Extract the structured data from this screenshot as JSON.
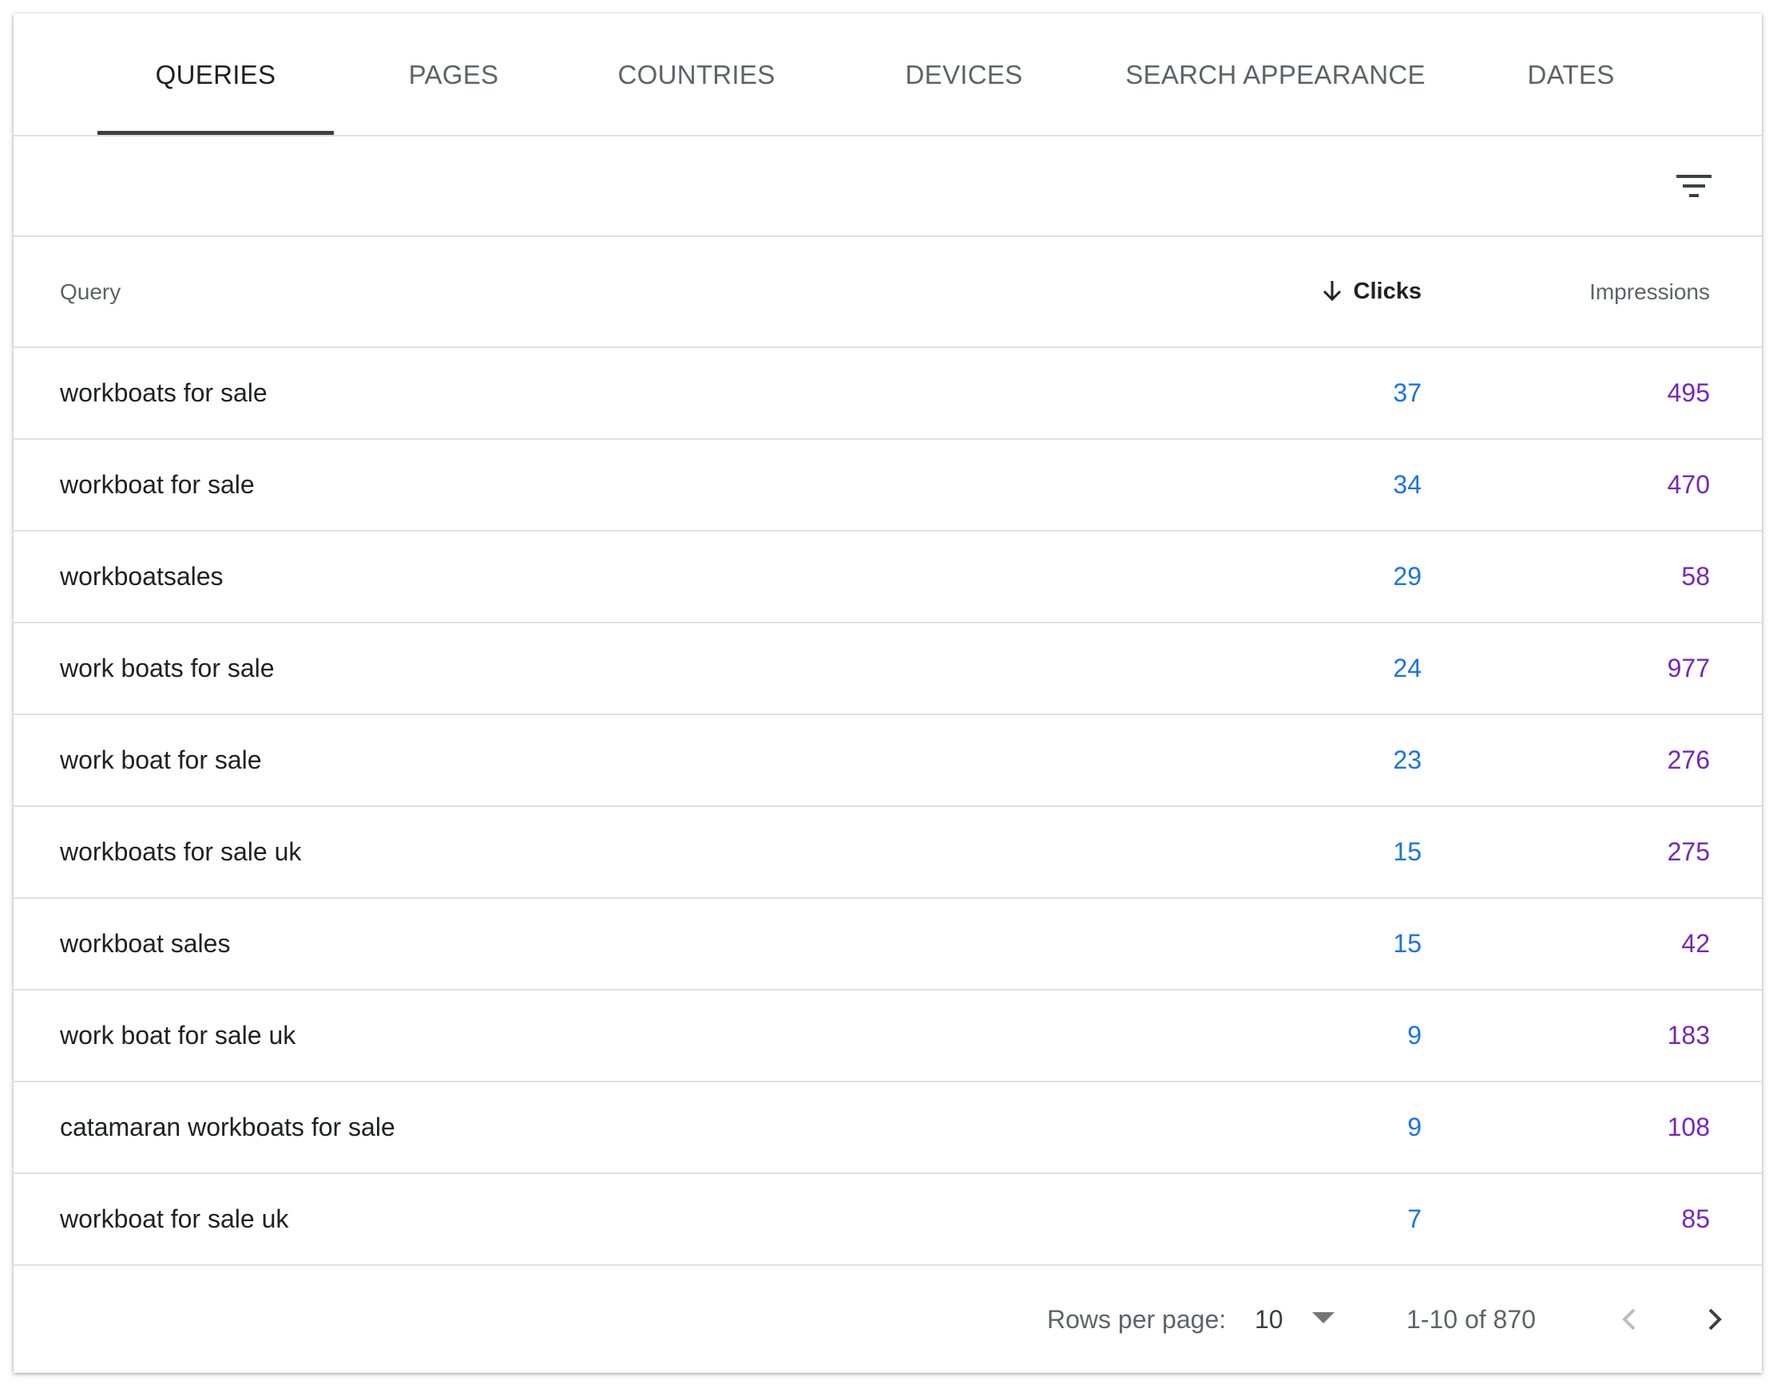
{
  "tabs": [
    {
      "label": "QUERIES",
      "active": true
    },
    {
      "label": "PAGES",
      "active": false
    },
    {
      "label": "COUNTRIES",
      "active": false
    },
    {
      "label": "DEVICES",
      "active": false
    },
    {
      "label": "SEARCH APPEARANCE",
      "active": false
    },
    {
      "label": "DATES",
      "active": false
    }
  ],
  "toolbar": {
    "filter_icon": "filter-list-icon"
  },
  "table": {
    "headers": {
      "query": "Query",
      "clicks": "Clicks",
      "impressions": "Impressions"
    },
    "sort": {
      "column": "clicks",
      "direction": "descending",
      "icon": "arrow-down-icon"
    },
    "rows": [
      {
        "query": "workboats for sale",
        "clicks": "37",
        "impressions": "495"
      },
      {
        "query": "workboat for sale",
        "clicks": "34",
        "impressions": "470"
      },
      {
        "query": "workboatsales",
        "clicks": "29",
        "impressions": "58"
      },
      {
        "query": "work boats for sale",
        "clicks": "24",
        "impressions": "977"
      },
      {
        "query": "work boat for sale",
        "clicks": "23",
        "impressions": "276"
      },
      {
        "query": "workboats for sale uk",
        "clicks": "15",
        "impressions": "275"
      },
      {
        "query": "workboat sales",
        "clicks": "15",
        "impressions": "42"
      },
      {
        "query": "work boat for sale uk",
        "clicks": "9",
        "impressions": "183"
      },
      {
        "query": "catamaran workboats for sale",
        "clicks": "9",
        "impressions": "108"
      },
      {
        "query": "workboat for sale uk",
        "clicks": "7",
        "impressions": "85"
      }
    ]
  },
  "pagination": {
    "rows_per_page_label": "Rows per page:",
    "rows_per_page_value": "10",
    "range": "1-10 of 870"
  },
  "colors": {
    "clicks": "#1a73e8",
    "impressions": "#7627bb",
    "active_tab_indicator": "#3c4043"
  }
}
